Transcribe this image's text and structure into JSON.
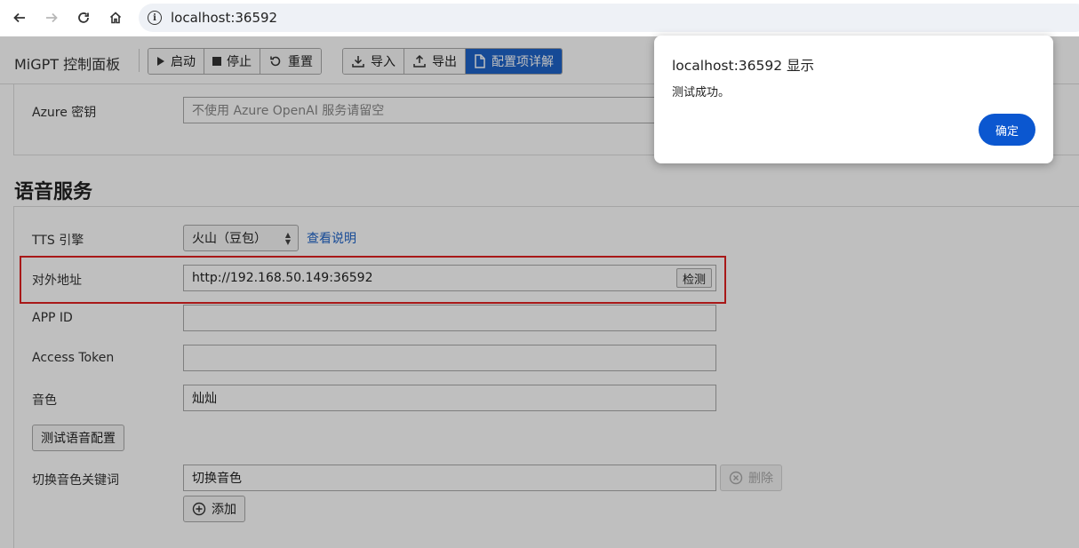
{
  "browser": {
    "url": "localhost:36592"
  },
  "toolbar": {
    "app_title": "MiGPT 控制面板",
    "start_label": "启动",
    "stop_label": "停止",
    "reset_label": "重置",
    "import_label": "导入",
    "export_label": "导出",
    "config_detail_label": "配置项详解"
  },
  "azure": {
    "key_label": "Azure 密钥",
    "key_placeholder": "不使用 Azure OpenAI 服务请留空"
  },
  "voice": {
    "heading": "语音服务",
    "tts_label": "TTS 引擎",
    "tts_value": "火山（豆包）",
    "tts_link": "查看说明",
    "public_address_label": "对外地址",
    "public_address_value": "http://192.168.50.149:36592",
    "check_button": "检测",
    "app_id_label": "APP ID",
    "app_id_value": "",
    "access_token_label": "Access Token",
    "access_token_value": "",
    "timbre_label": "音色",
    "timbre_value": "灿灿",
    "test_button": "测试语音配置",
    "switch_keyword_label": "切换音色关键词",
    "switch_keyword_value": "切换音色",
    "delete_button": "删除",
    "add_button": "添加"
  },
  "dialog": {
    "title": "localhost:36592 显示",
    "message": "测试成功。",
    "ok_button": "确定"
  },
  "colors": {
    "primary": "#1e63c8",
    "dialog_button": "#0b57d0",
    "highlight": "#e02020"
  }
}
